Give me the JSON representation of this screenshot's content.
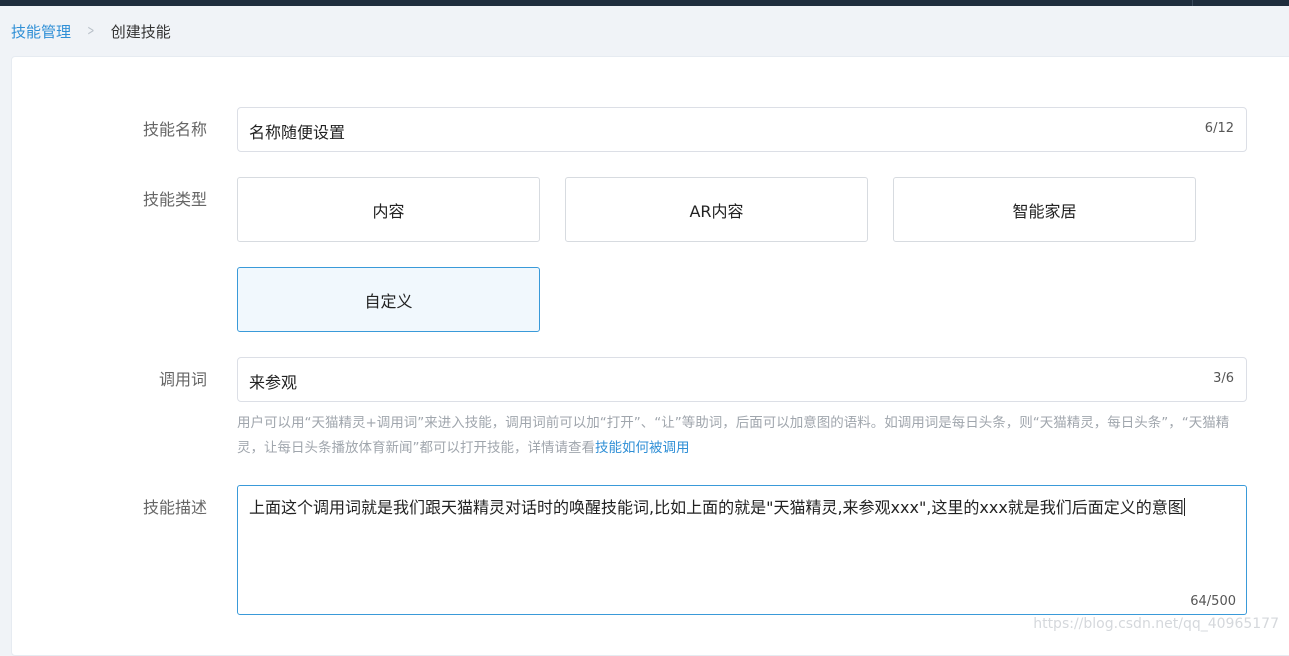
{
  "breadcrumb": {
    "parent": "技能管理",
    "current": "创建技能"
  },
  "form": {
    "name": {
      "label": "技能名称",
      "value": "名称随便设置",
      "counter": "6/12"
    },
    "type": {
      "label": "技能类型",
      "options": [
        "内容",
        "AR内容",
        "智能家居",
        "自定义"
      ],
      "selected": "自定义"
    },
    "invocation": {
      "label": "调用词",
      "value": "来参观",
      "counter": "3/6",
      "hint": "用户可以用“天猫精灵+调用词”来进入技能，调用词前可以加“打开”、“让”等助词，后面可以加意图的语料。如调用词是每日头条，则“天猫精灵，每日头条”，“天猫精灵，让每日头条播放体育新闻”都可以打开技能，详情请查看",
      "hint_link": "技能如何被调用"
    },
    "description": {
      "label": "技能描述",
      "value": "上面这个调用词就是我们跟天猫精灵对话时的唤醒技能词,比如上面的就是\"天猫精灵,来参观xxx\",这里的xxx就是我们后面定义的意图",
      "counter": "64/500"
    }
  },
  "watermark": "https://blog.csdn.net/qq_40965177",
  "colors": {
    "accent": "#2f8fd6",
    "selected_border": "#3a9ad9",
    "topbar": "#1f2d3d"
  }
}
